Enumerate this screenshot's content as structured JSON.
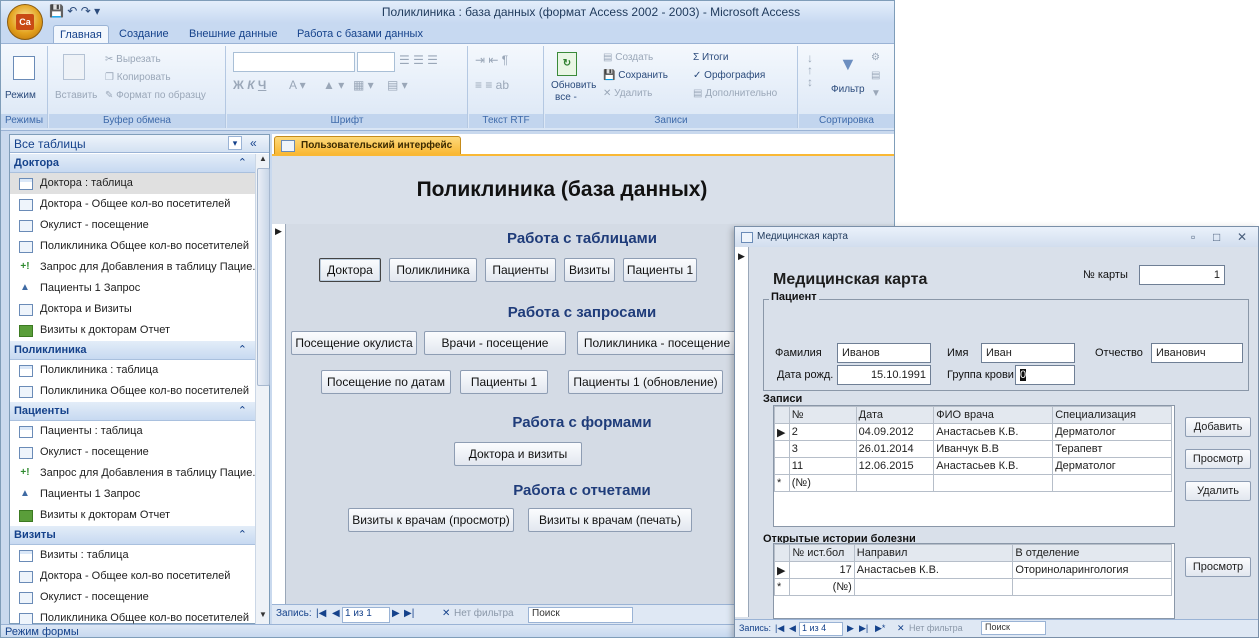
{
  "app": {
    "title": "Поликлиника : база данных (формат Access 2002 - 2003)  -  Microsoft Access",
    "office_button_label": "Ca"
  },
  "ribbon": {
    "tabs": [
      "Главная",
      "Создание",
      "Внешние данные",
      "Работа с базами данных"
    ],
    "groups": {
      "modes": {
        "label": "Режимы",
        "mode": "Режим"
      },
      "clipboard": {
        "label": "Буфер обмена",
        "paste": "Вставить",
        "cut": "Вырезать",
        "copy": "Копировать",
        "format_painter": "Формат по образцу"
      },
      "font": {
        "label": "Шрифт"
      },
      "rtf": {
        "label": "Текст RTF"
      },
      "records": {
        "label": "Записи",
        "refresh": "Обновить",
        "refresh2": "все -",
        "new": "Создать",
        "save": "Сохранить",
        "delete": "Удалить",
        "totals": "Итоги",
        "spelling": "Орфография",
        "more": "Дополнительно"
      },
      "sort": {
        "label": "Сортировка",
        "filter": "Фильтр"
      }
    }
  },
  "nav": {
    "title": "Все таблицы",
    "groups": [
      {
        "name": "Доктора",
        "items": [
          {
            "icon": "table-icon",
            "label": "Доктора : таблица",
            "selected": true
          },
          {
            "icon": "form-icon",
            "label": "Доктора - Общее кол-во посетителей"
          },
          {
            "icon": "form-icon",
            "label": "Окулист - посещение"
          },
          {
            "icon": "form-icon",
            "label": "Поликлиника Общее кол-во посетителей"
          },
          {
            "icon": "append-query-icon",
            "label": "Запрос для Добавления в таблицу Пацие..."
          },
          {
            "icon": "query-icon",
            "label": "Пациенты 1 Запрос"
          },
          {
            "icon": "form-icon",
            "label": "Доктора и Визиты"
          },
          {
            "icon": "report-icon",
            "label": "Визиты к докторам Отчет"
          }
        ]
      },
      {
        "name": "Поликлиника",
        "items": [
          {
            "icon": "table-icon",
            "label": "Поликлиника : таблица"
          },
          {
            "icon": "form-icon",
            "label": "Поликлиника Общее кол-во посетителей"
          }
        ]
      },
      {
        "name": "Пациенты",
        "items": [
          {
            "icon": "table-icon",
            "label": "Пациенты : таблица"
          },
          {
            "icon": "form-icon",
            "label": "Окулист - посещение"
          },
          {
            "icon": "append-query-icon",
            "label": "Запрос для Добавления в таблицу Пацие..."
          },
          {
            "icon": "query-icon",
            "label": "Пациенты 1 Запрос"
          },
          {
            "icon": "report-icon",
            "label": "Визиты к докторам Отчет"
          }
        ]
      },
      {
        "name": "Визиты",
        "items": [
          {
            "icon": "table-icon",
            "label": "Визиты : таблица"
          },
          {
            "icon": "form-icon",
            "label": "Доктора - Общее кол-во посетителей"
          },
          {
            "icon": "form-icon",
            "label": "Окулист - посещение"
          },
          {
            "icon": "form-icon",
            "label": "Поликлиника Общее кол-во посетителей"
          }
        ]
      }
    ]
  },
  "ui_form": {
    "tab": "Пользовательский интерфейс",
    "title": "Поликлиника (база данных)",
    "sections": {
      "tables": "Работа с таблицами",
      "queries": "Работа с запросами",
      "forms": "Работа с формами",
      "reports": "Работа с отчетами"
    },
    "table_buttons": [
      "Доктора",
      "Поликлиника",
      "Пациенты",
      "Визиты",
      "Пациенты 1"
    ],
    "query_buttons_row1": [
      "Посещение окулиста",
      "Врачи - посещение",
      "Поликлиника - посещение"
    ],
    "query_buttons_row2": [
      "Посещение по датам",
      "Пациенты 1",
      "Пациенты 1 (обновление)"
    ],
    "form_buttons": [
      "Доктора и визиты"
    ],
    "report_buttons": [
      "Визиты к врачам (просмотр)",
      "Визиты к врачам (печать)"
    ],
    "navbar": {
      "label": "Запись:",
      "position": "1 из 1",
      "filter": "Нет фильтра",
      "search": "Поиск"
    }
  },
  "card": {
    "window_title": "Медицинская карта",
    "title": "Медицинская карта",
    "card_no_label": "№ карты",
    "card_no": "1",
    "patient_section": "Пациент",
    "surname_label": "Фамилия",
    "surname": "Иванов",
    "name_label": "Имя",
    "name": "Иван",
    "patronymic_label": "Отчество",
    "patronymic": "Иванович",
    "dob_label": "Дата рожд.",
    "dob": "15.10.1991",
    "blood_label": "Группа крови",
    "blood": "0",
    "records_section": "Записи",
    "records_headers": [
      "№",
      "Дата",
      "ФИО врача",
      "Специализация"
    ],
    "records_rows": [
      [
        "2",
        "04.09.2012",
        "Анастасьев К.В.",
        "Дерматолог"
      ],
      [
        "3",
        "26.01.2014",
        "Иванчук В.В",
        "Терапевт"
      ],
      [
        "11",
        "12.06.2015",
        "Анастасьев К.В.",
        "Дерматолог"
      ]
    ],
    "new_row_placeholder": "(№)",
    "btn_add": "Добавить",
    "btn_view": "Просмотр",
    "btn_delete": "Удалить",
    "history_section": "Открытые истории болезни",
    "history_headers": [
      "№ ист.бол",
      "Направил",
      "В отделение"
    ],
    "history_rows": [
      [
        "17",
        "Анастасьев К.В.",
        "Оториноларингология"
      ]
    ],
    "btn_view2": "Просмотр",
    "navbar": {
      "label": "Запись:",
      "position": "1 из 4",
      "filter": "Нет фильтра",
      "search": "Поиск"
    }
  },
  "status": "Режим формы"
}
